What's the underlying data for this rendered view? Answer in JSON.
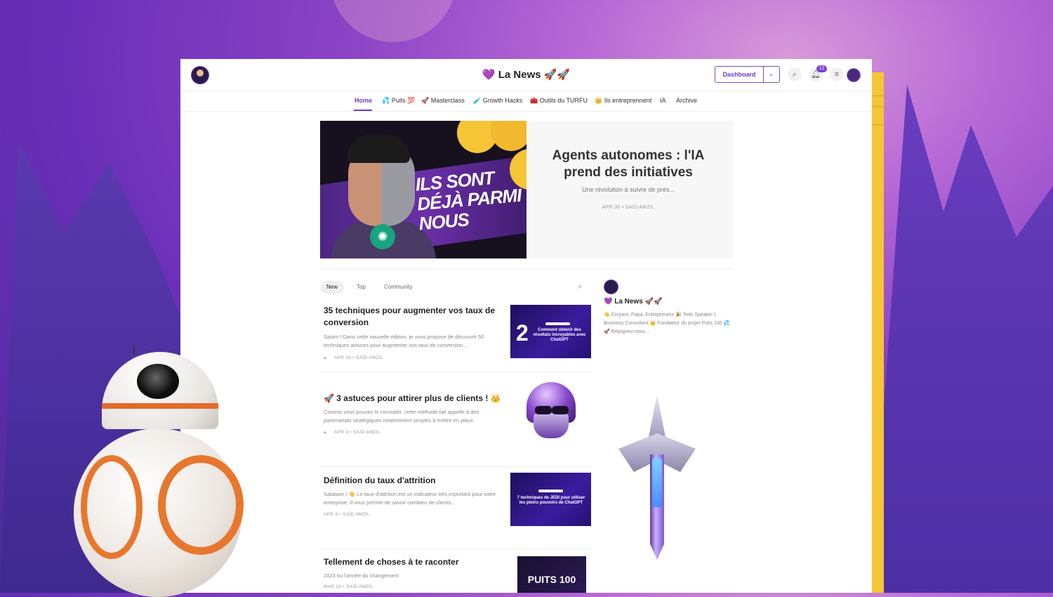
{
  "header": {
    "site_title": "💜 La News 🚀🚀",
    "dashboard_label": "Dashboard",
    "notification_count": "12",
    "icons": [
      "search-icon",
      "bell-icon",
      "menu-icon"
    ]
  },
  "nav": {
    "items": [
      "Home",
      "💦 Puits 💯",
      "🚀 Masterclass",
      "🧪 Growth Hacks",
      "🧰 Outils du TURFU",
      "👑 Ils entreprennent",
      "IA",
      "Archive"
    ]
  },
  "hero": {
    "image_text": "ILS SONT DÉJÀ PARMI NOUS",
    "title": "Agents autonomes : l'IA prend des initiatives",
    "subtitle": "Une révolution à suivre de près...",
    "meta": "APR 30 • SAÏD AMZIL"
  },
  "feed": {
    "tabs": [
      "New",
      "Top",
      "Community"
    ]
  },
  "posts": [
    {
      "title": "35 techniques pour augmenter vos taux de conversion",
      "desc": "Salam ! Dans cette nouvelle édition, je vous propose de découvrir 50 techniques astuces pour augmenter vos taux de conversion....",
      "meta": "APR 16 • SAÏD AMZIL",
      "thumb_number": "2",
      "thumb_caption": "Comment obtenir des résultats incroyables avec ChatGPT"
    },
    {
      "title": "🚀 3 astuces pour attirer plus de clients ! 👑",
      "desc": "Comme vous pouvez le constater, cette méthode fait appelle à des partenariats stratégiques relativement simples à mettre en place.",
      "meta": "APR 9 • SAÏD AMZIL"
    },
    {
      "title": "Définition du taux d'attrition",
      "desc": "Salaaam ! 👋 Le taux d'attrition est un indicateur très important pour votre entreprise. Il vous permet de savoir combien de clients...",
      "meta": "APR 9 • SAÏD AMZIL",
      "thumb_caption": "7 techniques de JEDI pour utiliser les pleins pouvoirs de ChatGPT"
    },
    {
      "title": "Tellement de choses à te raconter",
      "desc": "2023 ou l'année du changement",
      "meta": "MAR 23 • SAÏD AMZIL",
      "thumb_caption": "PUITS 100"
    }
  ],
  "sidebar": {
    "name": "💜 La News 🚀🚀",
    "bio": "👋 Croyant, Papa, Entrepreneur 🎉 Tedx Speaker | Business Consultant 👑 Fondateur du projet Puits 100 💦🚀 Rejoignez-nous..."
  },
  "colors": {
    "accent": "#6d3cc0",
    "badge": "#7a3fd8",
    "background_purple": "#8a43c4",
    "strip_yellow": "#f5c536"
  }
}
